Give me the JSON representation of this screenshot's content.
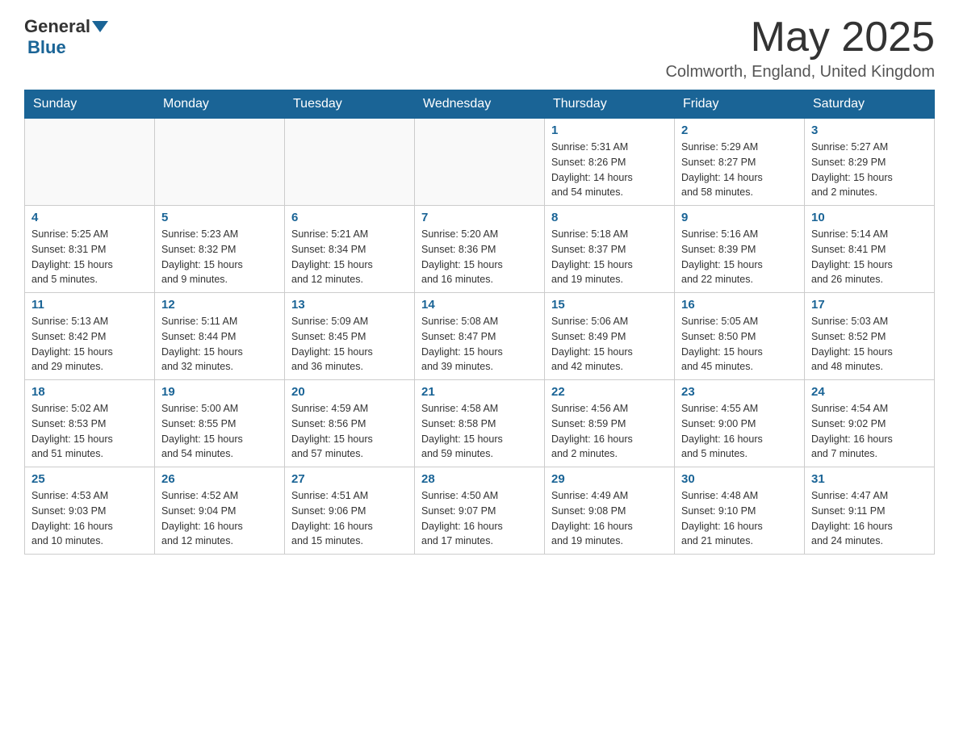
{
  "header": {
    "logo_general": "General",
    "logo_blue": "Blue",
    "month_title": "May 2025",
    "location": "Colmworth, England, United Kingdom"
  },
  "weekdays": [
    "Sunday",
    "Monday",
    "Tuesday",
    "Wednesday",
    "Thursday",
    "Friday",
    "Saturday"
  ],
  "weeks": [
    [
      {
        "day": "",
        "info": ""
      },
      {
        "day": "",
        "info": ""
      },
      {
        "day": "",
        "info": ""
      },
      {
        "day": "",
        "info": ""
      },
      {
        "day": "1",
        "info": "Sunrise: 5:31 AM\nSunset: 8:26 PM\nDaylight: 14 hours\nand 54 minutes."
      },
      {
        "day": "2",
        "info": "Sunrise: 5:29 AM\nSunset: 8:27 PM\nDaylight: 14 hours\nand 58 minutes."
      },
      {
        "day": "3",
        "info": "Sunrise: 5:27 AM\nSunset: 8:29 PM\nDaylight: 15 hours\nand 2 minutes."
      }
    ],
    [
      {
        "day": "4",
        "info": "Sunrise: 5:25 AM\nSunset: 8:31 PM\nDaylight: 15 hours\nand 5 minutes."
      },
      {
        "day": "5",
        "info": "Sunrise: 5:23 AM\nSunset: 8:32 PM\nDaylight: 15 hours\nand 9 minutes."
      },
      {
        "day": "6",
        "info": "Sunrise: 5:21 AM\nSunset: 8:34 PM\nDaylight: 15 hours\nand 12 minutes."
      },
      {
        "day": "7",
        "info": "Sunrise: 5:20 AM\nSunset: 8:36 PM\nDaylight: 15 hours\nand 16 minutes."
      },
      {
        "day": "8",
        "info": "Sunrise: 5:18 AM\nSunset: 8:37 PM\nDaylight: 15 hours\nand 19 minutes."
      },
      {
        "day": "9",
        "info": "Sunrise: 5:16 AM\nSunset: 8:39 PM\nDaylight: 15 hours\nand 22 minutes."
      },
      {
        "day": "10",
        "info": "Sunrise: 5:14 AM\nSunset: 8:41 PM\nDaylight: 15 hours\nand 26 minutes."
      }
    ],
    [
      {
        "day": "11",
        "info": "Sunrise: 5:13 AM\nSunset: 8:42 PM\nDaylight: 15 hours\nand 29 minutes."
      },
      {
        "day": "12",
        "info": "Sunrise: 5:11 AM\nSunset: 8:44 PM\nDaylight: 15 hours\nand 32 minutes."
      },
      {
        "day": "13",
        "info": "Sunrise: 5:09 AM\nSunset: 8:45 PM\nDaylight: 15 hours\nand 36 minutes."
      },
      {
        "day": "14",
        "info": "Sunrise: 5:08 AM\nSunset: 8:47 PM\nDaylight: 15 hours\nand 39 minutes."
      },
      {
        "day": "15",
        "info": "Sunrise: 5:06 AM\nSunset: 8:49 PM\nDaylight: 15 hours\nand 42 minutes."
      },
      {
        "day": "16",
        "info": "Sunrise: 5:05 AM\nSunset: 8:50 PM\nDaylight: 15 hours\nand 45 minutes."
      },
      {
        "day": "17",
        "info": "Sunrise: 5:03 AM\nSunset: 8:52 PM\nDaylight: 15 hours\nand 48 minutes."
      }
    ],
    [
      {
        "day": "18",
        "info": "Sunrise: 5:02 AM\nSunset: 8:53 PM\nDaylight: 15 hours\nand 51 minutes."
      },
      {
        "day": "19",
        "info": "Sunrise: 5:00 AM\nSunset: 8:55 PM\nDaylight: 15 hours\nand 54 minutes."
      },
      {
        "day": "20",
        "info": "Sunrise: 4:59 AM\nSunset: 8:56 PM\nDaylight: 15 hours\nand 57 minutes."
      },
      {
        "day": "21",
        "info": "Sunrise: 4:58 AM\nSunset: 8:58 PM\nDaylight: 15 hours\nand 59 minutes."
      },
      {
        "day": "22",
        "info": "Sunrise: 4:56 AM\nSunset: 8:59 PM\nDaylight: 16 hours\nand 2 minutes."
      },
      {
        "day": "23",
        "info": "Sunrise: 4:55 AM\nSunset: 9:00 PM\nDaylight: 16 hours\nand 5 minutes."
      },
      {
        "day": "24",
        "info": "Sunrise: 4:54 AM\nSunset: 9:02 PM\nDaylight: 16 hours\nand 7 minutes."
      }
    ],
    [
      {
        "day": "25",
        "info": "Sunrise: 4:53 AM\nSunset: 9:03 PM\nDaylight: 16 hours\nand 10 minutes."
      },
      {
        "day": "26",
        "info": "Sunrise: 4:52 AM\nSunset: 9:04 PM\nDaylight: 16 hours\nand 12 minutes."
      },
      {
        "day": "27",
        "info": "Sunrise: 4:51 AM\nSunset: 9:06 PM\nDaylight: 16 hours\nand 15 minutes."
      },
      {
        "day": "28",
        "info": "Sunrise: 4:50 AM\nSunset: 9:07 PM\nDaylight: 16 hours\nand 17 minutes."
      },
      {
        "day": "29",
        "info": "Sunrise: 4:49 AM\nSunset: 9:08 PM\nDaylight: 16 hours\nand 19 minutes."
      },
      {
        "day": "30",
        "info": "Sunrise: 4:48 AM\nSunset: 9:10 PM\nDaylight: 16 hours\nand 21 minutes."
      },
      {
        "day": "31",
        "info": "Sunrise: 4:47 AM\nSunset: 9:11 PM\nDaylight: 16 hours\nand 24 minutes."
      }
    ]
  ]
}
